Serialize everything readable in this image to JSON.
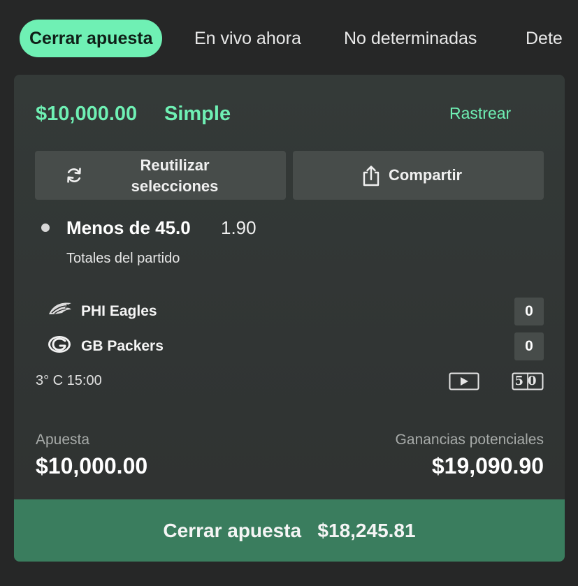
{
  "tabs": [
    {
      "label": "Cerrar apuesta",
      "active": true
    },
    {
      "label": "En vivo ahora",
      "active": false
    },
    {
      "label": "No determinadas",
      "active": false
    },
    {
      "label": "Dete",
      "active": false
    }
  ],
  "bet": {
    "amount": "$10,000.00",
    "type": "Simple",
    "track_label": "Rastrear",
    "reuse_label_line1": "Reutilizar",
    "reuse_label_line2": "selecciones",
    "share_label": "Compartir",
    "selection": {
      "title": "Menos de 45.0",
      "odds": "1.90",
      "market": "Totales del partido"
    },
    "teams": [
      {
        "name": "PHI Eagles",
        "score": "0",
        "logo_icon": "eagles-logo-icon"
      },
      {
        "name": "GB Packers",
        "score": "0",
        "logo_icon": "packers-logo-icon"
      }
    ],
    "game_time": "3° C  15:00",
    "icons": {
      "video": "play-video-icon",
      "stats": "stats-50-icon"
    },
    "stats_icon_text": "50",
    "stake_label": "Apuesta",
    "stake_value": "$10,000.00",
    "potential_label": "Ganancias potenciales",
    "potential_value": "$19,090.90",
    "cashout_label": "Cerrar apuesta",
    "cashout_value": "$18,245.81"
  },
  "colors": {
    "accent": "#6ff0b4",
    "cashout_bg": "#3a7d5e",
    "card_bg": "#343a38",
    "page_bg": "#262727"
  }
}
